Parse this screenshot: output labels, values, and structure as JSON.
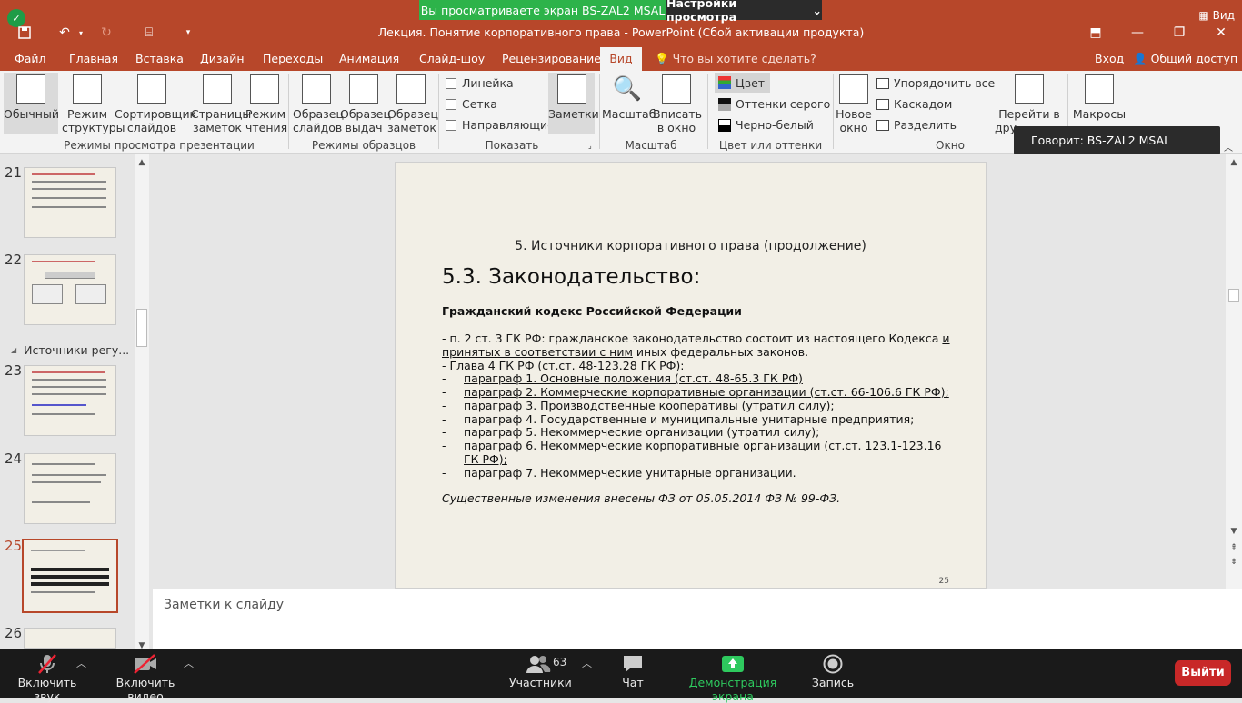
{
  "zoom": {
    "share_banner": "Вы просматриваете экран BS-ZAL2 MSAL",
    "view_settings": "Настройки просмотра",
    "view_label": "Вид",
    "tooltip": "Говорит: BS-ZAL2 MSAL",
    "toolbar": {
      "mute": "Включить звук",
      "video": "Включить видео",
      "participants": "Участники",
      "participants_count": "63",
      "chat": "Чат",
      "share": "Демонстрация экрана",
      "record": "Запись",
      "leave": "Выйти"
    }
  },
  "window": {
    "title": "Лекция. Понятие корпоративного права - PowerPoint (Сбой активации продукта)"
  },
  "menu": {
    "tabs": [
      "Файл",
      "Главная",
      "Вставка",
      "Дизайн",
      "Переходы",
      "Анимация",
      "Слайд-шоу",
      "Рецензирование",
      "Вид"
    ],
    "active": "Вид",
    "tellme": "Что вы хотите сделать?",
    "signin": "Вход",
    "share": "Общий доступ"
  },
  "ribbon": {
    "views": {
      "normal": "Обычный",
      "outline": [
        "Режим",
        "структуры"
      ],
      "sorter": [
        "Сортировщик",
        "слайдов"
      ],
      "notes_page": [
        "Страницы",
        "заметок"
      ],
      "reading": [
        "Режим",
        "чтения"
      ],
      "label": "Режимы просмотра презентации"
    },
    "masters": {
      "slide": [
        "Образец",
        "слайдов"
      ],
      "handout": [
        "Образец",
        "выдач"
      ],
      "notes": [
        "Образец",
        "заметок"
      ],
      "label": "Режимы образцов"
    },
    "show": {
      "ruler": "Линейка",
      "grid": "Сетка",
      "guides": "Направляющие",
      "notes": "Заметки",
      "label": "Показать"
    },
    "zoom": {
      "zoom": "Масштаб",
      "fit": [
        "Вписать",
        "в окно"
      ],
      "label": "Масштаб"
    },
    "color": {
      "color": "Цвет",
      "grayscale": "Оттенки серого",
      "bw": "Черно-белый",
      "label": "Цвет или оттенки серого"
    },
    "window": {
      "new": [
        "Новое",
        "окно"
      ],
      "arrange": "Упорядочить все",
      "cascade": "Каскадом",
      "split": "Разделить",
      "switch": [
        "Перейти в",
        "дру"
      ],
      "label": "Окно"
    },
    "macros": "Макросы"
  },
  "thumbnails": {
    "numbers": [
      "21",
      "22",
      "23",
      "24",
      "25",
      "26"
    ],
    "current": "25",
    "section": "Источники регу..."
  },
  "slide": {
    "subtitle": "5. Источники корпоративного права (продолжение)",
    "heading": "5.3. Законодательство:",
    "bold": "Гражданский кодекс Российской Федерации",
    "p1a": "- п. 2 ст. 3 ГК РФ: гражданское законодательство состоит из настоящего Кодекса ",
    "p1b": "и",
    "p1c": "принятых в соответствии с ним",
    "p1d": " иных федеральных законов.",
    "ch4": "- Глава 4 ГК РФ (ст.ст. 48-123.28 ГК РФ):",
    "items": [
      "параграф 1. Основные положения (ст.ст. 48-65.3 ГК РФ)",
      "параграф 2. Коммерческие корпоративные организации (ст.ст. 66-106.6 ГК РФ);",
      "параграф 3. Производственные кооперативы (утратил силу);",
      "параграф 4. Государственные и муниципальные унитарные предприятия;",
      "параграф 5. Некоммерческие организации (утратил силу);",
      "параграф 6. Некоммерческие корпоративные организации (ст.ст. 123.1-123.16",
      "ГК РФ);",
      "параграф 7. Некоммерческие унитарные организации."
    ],
    "italic": "Существенные изменения внесены ФЗ от 05.05.2014 ФЗ № 99-ФЗ.",
    "page": "25"
  },
  "notes_placeholder": "Заметки к слайду"
}
